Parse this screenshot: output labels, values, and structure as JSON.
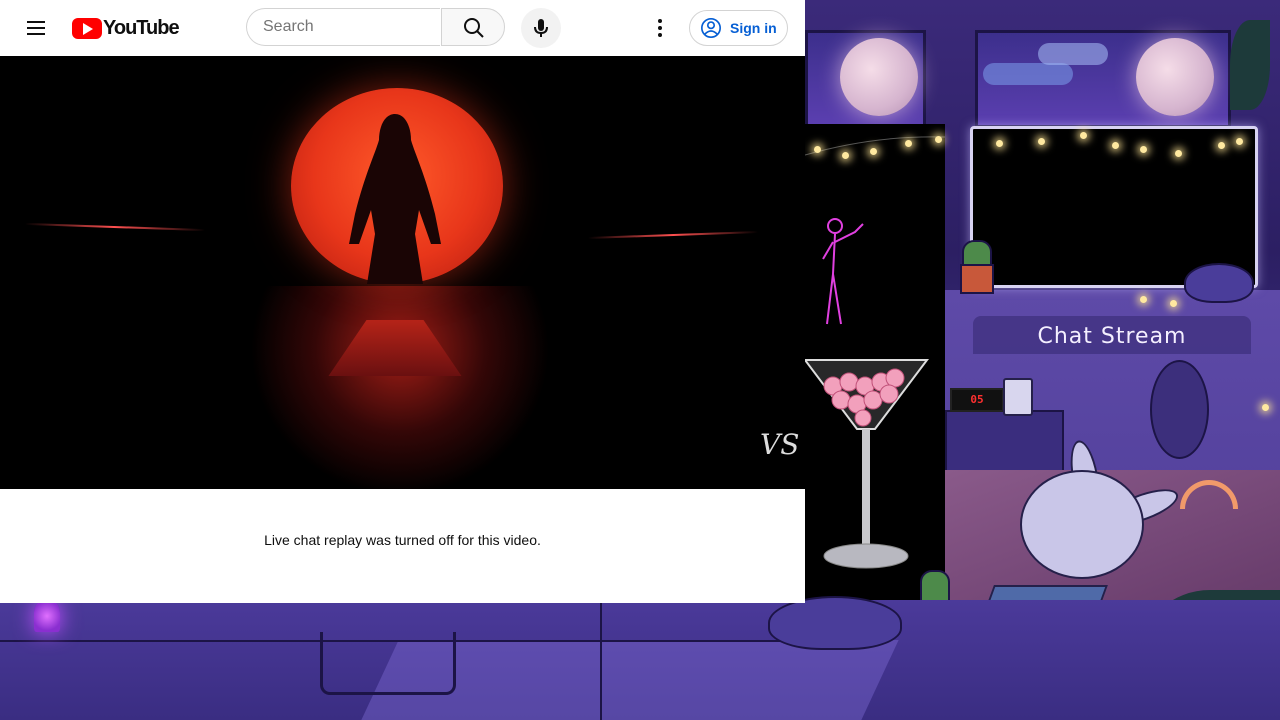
{
  "youtube": {
    "logo_text": "YouTube",
    "search": {
      "placeholder": "Search"
    },
    "sign_in_label": "Sign in",
    "brand_color": "#ff0000",
    "link_color": "#065fd4",
    "icons": [
      "menu-icon",
      "youtube-logo-icon",
      "search-icon",
      "mic-icon",
      "more-vert-icon",
      "account-circle-icon"
    ]
  },
  "video": {
    "watermark": "VS"
  },
  "live_chat": {
    "message": "Live chat replay was turned off for this video."
  },
  "overlay": {
    "chat_title": "Chat Stream",
    "clock_text": "05"
  }
}
